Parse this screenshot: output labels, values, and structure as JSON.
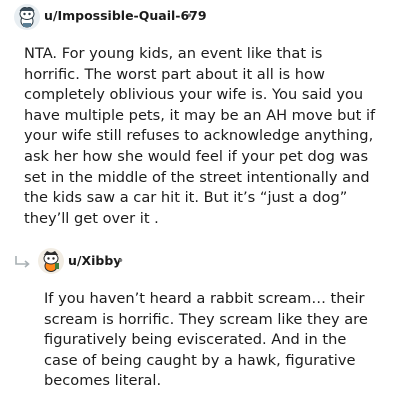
{
  "comments": [
    {
      "username": "u/Impossible-Quail-679",
      "separator": "•",
      "avatar_icon": "snoo-avatar-icon",
      "body": "NTA. For young kids, an event like that is horrific. The worst part about it all is how completely oblivious your wife is. You said you have multiple pets, it may be an AH move but if your wife still refuses to acknowledge anything, ask her how she would feel if your pet dog was set in the middle of the street intentionally and the kids saw a car hit it. But it’s “just a dog” they’ll get over it ."
    },
    {
      "username": "u/Xibby",
      "separator": "•",
      "avatar_icon": "snoo-avatar-icon",
      "reply_icon": "reply-arrow-icon",
      "body": "If you haven’t heard a rabbit scream… their scream is horrific. They scream like they are figuratively being eviscerated. And in the case of being caught by a hawk, figurative becomes literal."
    }
  ],
  "colors": {
    "text": "#1c1c1c",
    "meta": "#7c7c7c",
    "reply_arrow": "#a8b0b4"
  }
}
